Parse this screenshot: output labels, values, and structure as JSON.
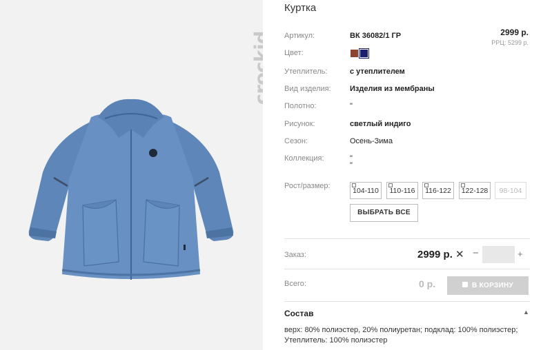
{
  "brand": "crockid",
  "product": {
    "title": "Куртка",
    "price": "2999 р.",
    "rrp": "PPЦ: 5299 р."
  },
  "attributes": [
    {
      "label": "Артикул:",
      "value": "ВК 36082/1 ГР"
    },
    {
      "label": "Цвет:",
      "value": ""
    },
    {
      "label": "Утеплитель:",
      "value": "с утеплителем"
    },
    {
      "label": "Вид изделия:",
      "value": "Изделия из мембраны"
    },
    {
      "label": "Полотно:",
      "value": "\""
    },
    {
      "label": "Рисунок:",
      "value": "светлый индиго"
    },
    {
      "label": "Сезон:",
      "value": "Осень-Зима"
    },
    {
      "label": "Коллекция:",
      "value": "\""
    },
    {
      "label": "Рост/размер:",
      "value": ""
    }
  ],
  "collection_extra": "\"",
  "colors": {
    "swatch1": "#8b4332",
    "swatch2": "#1a1f6e"
  },
  "sizes": [
    "104-110",
    "110-116",
    "116-122",
    "122-128",
    "98-104"
  ],
  "select_all": "ВЫБРАТЬ ВСЕ",
  "order": {
    "label": "Заказ:",
    "price": "2999 р.",
    "times": "✕",
    "minus": "−",
    "plus": "+",
    "qty": ""
  },
  "total": {
    "label": "Всего:",
    "value": "0 р.",
    "button": "В КОРЗИНУ"
  },
  "composition": {
    "title": "Состав",
    "line1": "верх: 80% полиэстер, 20% полиуретан; подклад: 100% полиэстер;",
    "line2": "Утеплитель: 100% полиэстер"
  }
}
